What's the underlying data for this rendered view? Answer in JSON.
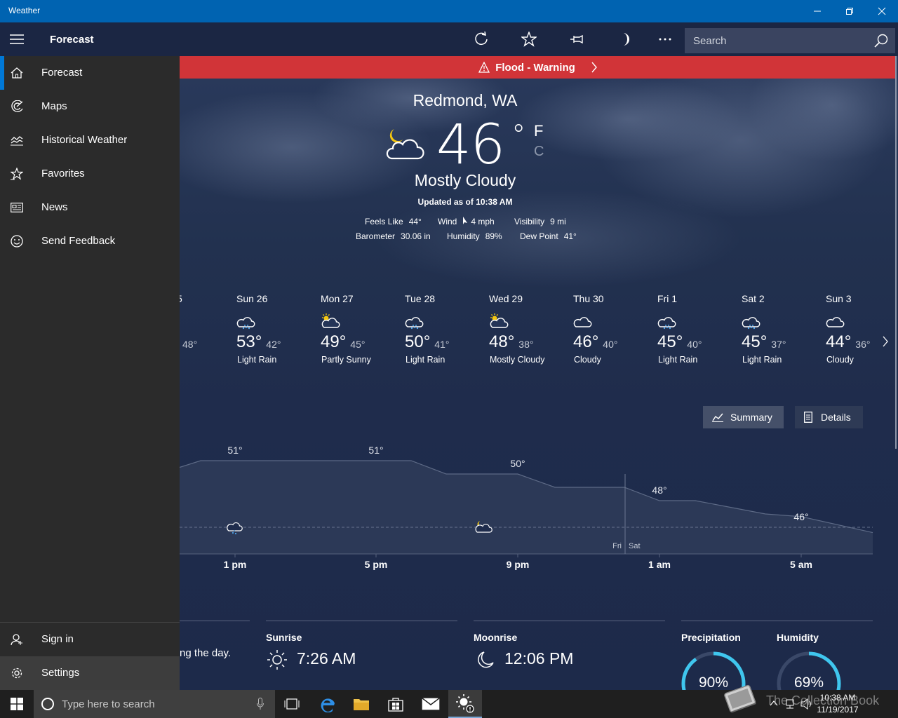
{
  "window": {
    "title": "Weather"
  },
  "toolbar": {
    "title": "Forecast",
    "search_placeholder": "Search"
  },
  "alert": {
    "label": "Flood - Warning"
  },
  "current": {
    "location": "Redmond, WA",
    "temperature": "46",
    "degree": "°",
    "unit_f": "F",
    "unit_c": "C",
    "condition": "Mostly Cloudy",
    "updated": "Updated as of 10:38 AM",
    "details": {
      "feels_like_label": "Feels Like",
      "feels_like": "44°",
      "wind_label": "Wind",
      "wind": "4 mph",
      "visibility_label": "Visibility",
      "visibility": "9 mi",
      "barometer_label": "Barometer",
      "barometer": "30.06 in",
      "humidity_label": "Humidity",
      "humidity": "89%",
      "dew_point_label": "Dew Point",
      "dew_point": "41°"
    }
  },
  "daily": {
    "partial_prev": {
      "name": "5",
      "lo": "48°"
    },
    "days": [
      {
        "name": "Sun 26",
        "hi": "53°",
        "lo": "42°",
        "desc": "Light Rain",
        "icon": "rain-icon"
      },
      {
        "name": "Mon 27",
        "hi": "49°",
        "lo": "45°",
        "desc": "Partly Sunny",
        "icon": "partly-sunny-icon"
      },
      {
        "name": "Tue 28",
        "hi": "50°",
        "lo": "41°",
        "desc": "Light Rain",
        "icon": "rain-icon"
      },
      {
        "name": "Wed 29",
        "hi": "48°",
        "lo": "38°",
        "desc": "Mostly Cloudy",
        "icon": "partly-sunny-icon"
      },
      {
        "name": "Thu 30",
        "hi": "46°",
        "lo": "40°",
        "desc": "Cloudy",
        "icon": "cloud-icon"
      },
      {
        "name": "Fri 1",
        "hi": "45°",
        "lo": "40°",
        "desc": "Light Rain",
        "icon": "rain-icon"
      },
      {
        "name": "Sat 2",
        "hi": "45°",
        "lo": "37°",
        "desc": "Light Rain",
        "icon": "rain-icon"
      },
      {
        "name": "Sun 3",
        "hi": "44°",
        "lo": "36°",
        "desc": "Cloudy",
        "icon": "cloud-icon"
      }
    ]
  },
  "view_buttons": {
    "summary": "Summary",
    "details": "Details"
  },
  "chart_data": {
    "type": "area",
    "x": [
      "1 pm",
      "5 pm",
      "9 pm",
      "1 am",
      "5 am"
    ],
    "temperature_labels": [
      {
        "x": "1 pm",
        "label": "51°"
      },
      {
        "x": "5 pm",
        "label": "51°"
      },
      {
        "x": "9 pm",
        "label": "50°"
      },
      {
        "x": "1 am",
        "label": "48°"
      },
      {
        "x": "5 am",
        "label": "46°"
      }
    ],
    "values": [
      51,
      51,
      50,
      48,
      46
    ],
    "day_divider": {
      "left": "Fri",
      "right": "Sat"
    }
  },
  "hourly_labels": [
    "1 pm",
    "5 pm",
    "9 pm",
    "1 am",
    "5 am"
  ],
  "cards": {
    "summary_text": "ng the day.",
    "sunrise_label": "Sunrise",
    "sunrise": "7:26 AM",
    "moonrise_label": "Moonrise",
    "moonrise": "12:06 PM",
    "precip_label": "Precipitation",
    "precip": "90%",
    "precip_fraction": 0.9,
    "humidity_label": "Humidity",
    "humidity": "69%",
    "humidity_fraction": 0.69
  },
  "nav": {
    "items": [
      {
        "label": "Forecast",
        "icon": "home-icon"
      },
      {
        "label": "Maps",
        "icon": "radar-icon"
      },
      {
        "label": "Historical Weather",
        "icon": "chart-icon"
      },
      {
        "label": "Favorites",
        "icon": "star-list-icon"
      },
      {
        "label": "News",
        "icon": "news-icon"
      },
      {
        "label": "Send Feedback",
        "icon": "smiley-icon"
      }
    ],
    "sign_in": "Sign in",
    "settings": "Settings"
  },
  "taskbar": {
    "search_placeholder": "Type here to search",
    "time": "10:38 AM",
    "date": "11/19/2017"
  },
  "watermark": "The Collection Book",
  "colors": {
    "accent": "#0078d7",
    "alert": "#d13438",
    "gauge": "#3fc6ee",
    "titlebar": "#0063b1"
  }
}
